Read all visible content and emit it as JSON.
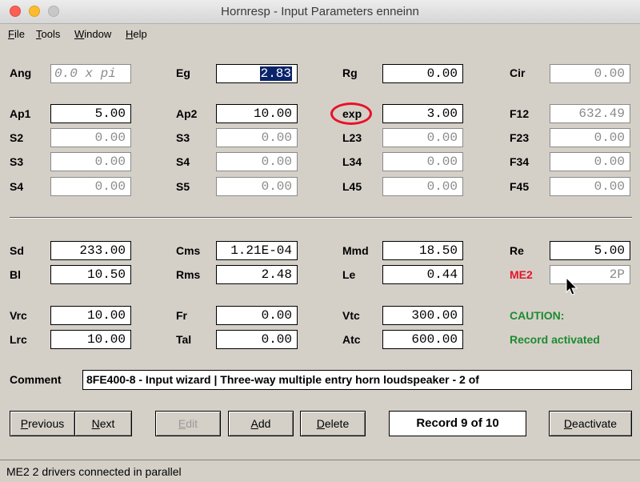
{
  "window": {
    "title": "Hornresp - Input Parameters   enneinn"
  },
  "menu": [
    "File",
    "Tools",
    "Window",
    "Help"
  ],
  "params": {
    "Ang": {
      "label": "Ang",
      "value": "0.0 x pi"
    },
    "Eg": {
      "label": "Eg",
      "value": "2.83"
    },
    "Rg": {
      "label": "Rg",
      "value": "0.00"
    },
    "Cir": {
      "label": "Cir",
      "value": "0.00"
    },
    "Ap1": {
      "label": "Ap1",
      "value": "5.00"
    },
    "Ap2": {
      "label": "Ap2",
      "value": "10.00"
    },
    "exp": {
      "label": "exp",
      "value": "3.00"
    },
    "F12": {
      "label": "F12",
      "value": "632.49"
    },
    "S2": {
      "label": "S2",
      "value": "0.00"
    },
    "S3a": {
      "label": "S3",
      "value": "0.00"
    },
    "L23": {
      "label": "L23",
      "value": "0.00"
    },
    "F23": {
      "label": "F23",
      "value": "0.00"
    },
    "S3b": {
      "label": "S3",
      "value": "0.00"
    },
    "S4a": {
      "label": "S4",
      "value": "0.00"
    },
    "L34": {
      "label": "L34",
      "value": "0.00"
    },
    "F34": {
      "label": "F34",
      "value": "0.00"
    },
    "S4b": {
      "label": "S4",
      "value": "0.00"
    },
    "S5": {
      "label": "S5",
      "value": "0.00"
    },
    "L45": {
      "label": "L45",
      "value": "0.00"
    },
    "F45": {
      "label": "F45",
      "value": "0.00"
    },
    "Sd": {
      "label": "Sd",
      "value": "233.00"
    },
    "Cms": {
      "label": "Cms",
      "value": "1.21E-04"
    },
    "Mmd": {
      "label": "Mmd",
      "value": "18.50"
    },
    "Re": {
      "label": "Re",
      "value": "5.00"
    },
    "Bl": {
      "label": "Bl",
      "value": "10.50"
    },
    "Rms": {
      "label": "Rms",
      "value": "2.48"
    },
    "Le": {
      "label": "Le",
      "value": "0.44"
    },
    "ME2": {
      "label": "ME2",
      "value": "2P"
    },
    "Vrc": {
      "label": "Vrc",
      "value": "10.00"
    },
    "Fr": {
      "label": "Fr",
      "value": "0.00"
    },
    "Vtc": {
      "label": "Vtc",
      "value": "300.00"
    },
    "Lrc": {
      "label": "Lrc",
      "value": "10.00"
    },
    "Tal": {
      "label": "Tal",
      "value": "0.00"
    },
    "Atc": {
      "label": "Atc",
      "value": "600.00"
    }
  },
  "caution": {
    "title": "CAUTION:",
    "message": "Record activated"
  },
  "comment": {
    "label": "Comment",
    "value": "8FE400-8 - Input wizard | Three-way multiple entry horn loudspeaker  -  2 of"
  },
  "buttons": {
    "previous": "Previous",
    "next": "Next",
    "edit": "Edit",
    "add": "Add",
    "delete": "Delete",
    "deactivate": "Deactivate"
  },
  "record": "Record 9 of 10",
  "status": "ME2   2 drivers connected in parallel",
  "colors": {
    "red": "#e8122a",
    "green": "#1e8a30",
    "selection": "#0a246a"
  }
}
